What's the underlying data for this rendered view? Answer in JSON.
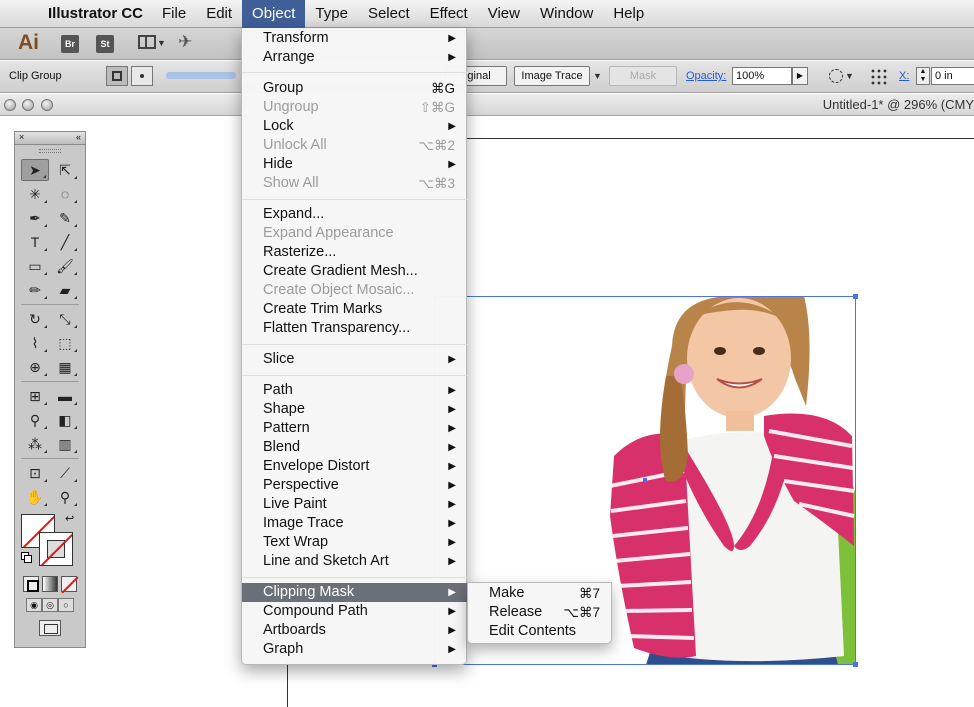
{
  "menubar": {
    "app_name": "Illustrator CC",
    "items": [
      "File",
      "Edit",
      "Object",
      "Type",
      "Select",
      "Effect",
      "View",
      "Window",
      "Help"
    ],
    "active": "Object"
  },
  "appbar": {
    "ai_label": "Ai",
    "br_label": "Br",
    "st_label": "St"
  },
  "controlbar": {
    "selection_label": "Clip Group",
    "edit_original_label": "riginal",
    "image_trace_label": "Image Trace",
    "mask_label": "Mask",
    "opacity_label": "Opacity:",
    "opacity_value": "100%",
    "x_label": "X:",
    "x_value": "0 in"
  },
  "document": {
    "title": "Untitled-1* @ 296% (CMY"
  },
  "object_menu": {
    "items": [
      {
        "label": "Transform",
        "submenu": true
      },
      {
        "label": "Arrange",
        "submenu": true
      },
      {
        "label": "Group",
        "shortcut": "⌘G"
      },
      {
        "label": "Ungroup",
        "shortcut": "⇧⌘G",
        "disabled": true
      },
      {
        "label": "Lock",
        "submenu": true
      },
      {
        "label": "Unlock All",
        "shortcut": "⌥⌘2",
        "disabled": true
      },
      {
        "label": "Hide",
        "submenu": true
      },
      {
        "label": "Show All",
        "shortcut": "⌥⌘3",
        "disabled": true
      },
      {
        "label": "Expand..."
      },
      {
        "label": "Expand Appearance",
        "disabled": true
      },
      {
        "label": "Rasterize..."
      },
      {
        "label": "Create Gradient Mesh..."
      },
      {
        "label": "Create Object Mosaic...",
        "disabled": true
      },
      {
        "label": "Create Trim Marks"
      },
      {
        "label": "Flatten Transparency..."
      },
      {
        "label": "Slice",
        "submenu": true
      },
      {
        "label": "Path",
        "submenu": true
      },
      {
        "label": "Shape",
        "submenu": true
      },
      {
        "label": "Pattern",
        "submenu": true
      },
      {
        "label": "Blend",
        "submenu": true
      },
      {
        "label": "Envelope Distort",
        "submenu": true
      },
      {
        "label": "Perspective",
        "submenu": true
      },
      {
        "label": "Live Paint",
        "submenu": true
      },
      {
        "label": "Image Trace",
        "submenu": true
      },
      {
        "label": "Text Wrap",
        "submenu": true
      },
      {
        "label": "Line and Sketch Art",
        "submenu": true
      },
      {
        "label": "Clipping Mask",
        "submenu": true,
        "highlighted": true
      },
      {
        "label": "Compound Path",
        "submenu": true
      },
      {
        "label": "Artboards",
        "submenu": true
      },
      {
        "label": "Graph",
        "submenu": true
      }
    ]
  },
  "clipping_mask_submenu": {
    "items": [
      {
        "label": "Make",
        "shortcut": "⌘7"
      },
      {
        "label": "Release",
        "shortcut": "⌥⌘7"
      },
      {
        "label": "Edit Contents"
      }
    ]
  },
  "colors": {
    "menu_active": "#3f5f98",
    "menu_highlight": "#6a6f78",
    "selection_blue": "#4c74e0"
  }
}
